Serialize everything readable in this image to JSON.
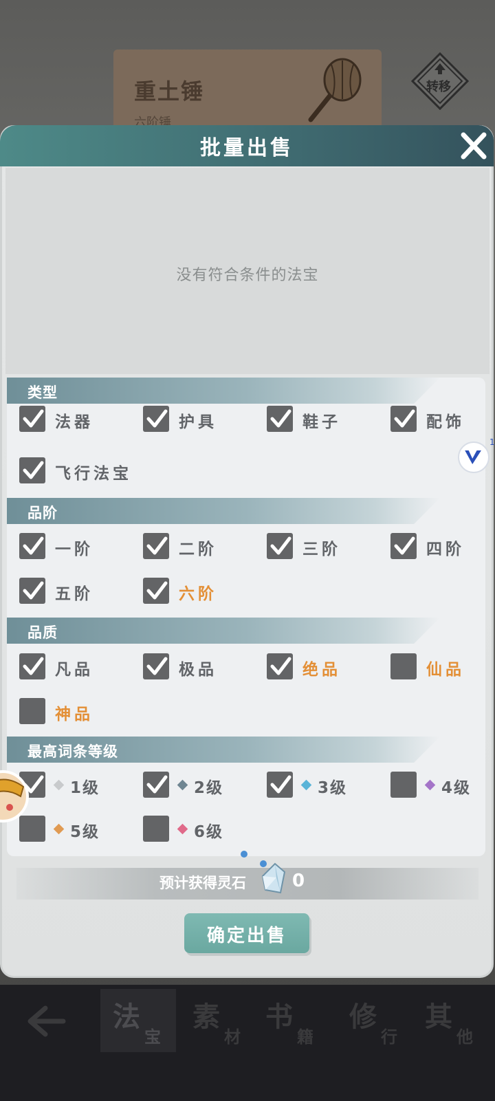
{
  "background": {
    "item_name": "重土锤",
    "item_subtitle": "六阶锤",
    "transfer_label": "转移"
  },
  "bottom_nav": {
    "tabs": [
      {
        "big": "法",
        "small": "宝"
      },
      {
        "big": "素",
        "small": "材"
      },
      {
        "big": "书",
        "small": "籍"
      },
      {
        "big": "修",
        "small": "行"
      },
      {
        "big": "其",
        "small": "他"
      }
    ]
  },
  "dialog": {
    "title": "批量出售",
    "empty_message": "没有符合条件的法宝",
    "sections": {
      "type": {
        "label": "类型",
        "options": [
          {
            "label": "法器",
            "checked": true
          },
          {
            "label": "护具",
            "checked": true
          },
          {
            "label": "鞋子",
            "checked": true
          },
          {
            "label": "配饰",
            "checked": true
          },
          {
            "label": "飞行法宝",
            "checked": true
          }
        ]
      },
      "grade": {
        "label": "品阶",
        "options": [
          {
            "label": "一阶",
            "checked": true
          },
          {
            "label": "二阶",
            "checked": true
          },
          {
            "label": "三阶",
            "checked": true
          },
          {
            "label": "四阶",
            "checked": true
          },
          {
            "label": "五阶",
            "checked": true
          },
          {
            "label": "六阶",
            "checked": true
          }
        ]
      },
      "quality": {
        "label": "品质",
        "options": [
          {
            "label": "凡品",
            "checked": true
          },
          {
            "label": "极品",
            "checked": true
          },
          {
            "label": "绝品",
            "checked": true
          },
          {
            "label": "仙品",
            "checked": false
          },
          {
            "label": "神品",
            "checked": false
          }
        ]
      },
      "affix_level": {
        "label": "最高词条等级",
        "options": [
          {
            "label": "1级",
            "checked": true,
            "color": "#c8cacc"
          },
          {
            "label": "2级",
            "checked": true,
            "color": "#6f8692"
          },
          {
            "label": "3级",
            "checked": true,
            "color": "#5ab4d8"
          },
          {
            "label": "4级",
            "checked": false,
            "color": "#a474c8"
          },
          {
            "label": "5级",
            "checked": false,
            "color": "#e09a52"
          },
          {
            "label": "6级",
            "checked": false,
            "color": "#e06a8a"
          }
        ]
      }
    },
    "estimate": {
      "label": "预计获得灵石",
      "value": "0"
    },
    "confirm_label": "确定出售"
  },
  "overlay": {
    "v_badge_count": "1"
  },
  "colors": {
    "header_teal": "#4e8a88",
    "checkbox": "#636466",
    "orange_text": "#e38f36",
    "confirm_button": "#72aea7"
  }
}
